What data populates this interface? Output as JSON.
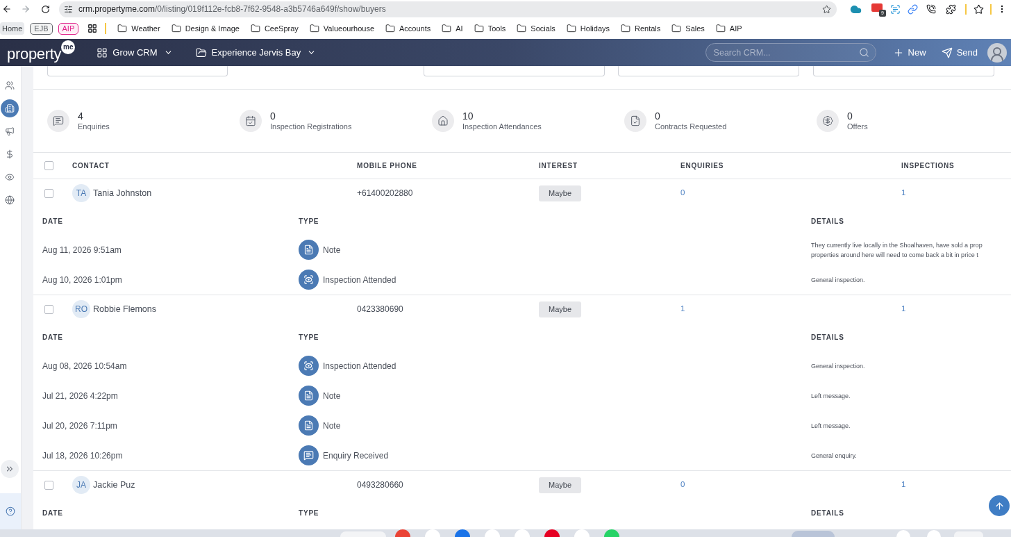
{
  "browser": {
    "url_host": "crm.propertyme.com",
    "url_path": "/0/listing/019f112e-fcb8-7f62-9548-a3b5746a649f/show/buyers",
    "extension_badge": "9",
    "bookmarks": [
      {
        "kind": "plain",
        "label": "Home"
      },
      {
        "kind": "tag",
        "label": "EJB",
        "color": "#5f6368"
      },
      {
        "kind": "tag",
        "label": "AIP",
        "color": "#e0218a"
      },
      {
        "kind": "apps"
      },
      {
        "kind": "separator"
      },
      {
        "kind": "folder",
        "label": "Weather"
      },
      {
        "kind": "folder",
        "label": "Design & Image"
      },
      {
        "kind": "folder",
        "label": "CeeSpray"
      },
      {
        "kind": "folder",
        "label": "Valueourhouse"
      },
      {
        "kind": "folder",
        "label": "Accounts"
      },
      {
        "kind": "folder",
        "label": "AI"
      },
      {
        "kind": "folder",
        "label": "Tools"
      },
      {
        "kind": "folder",
        "label": "Socials"
      },
      {
        "kind": "folder",
        "label": "Holidays"
      },
      {
        "kind": "folder",
        "label": "Rentals"
      },
      {
        "kind": "folder",
        "label": "Sales"
      },
      {
        "kind": "folder",
        "label": "AIP"
      }
    ]
  },
  "app_header": {
    "logo": {
      "text": "property",
      "badge": "me"
    },
    "nav": [
      {
        "kind": "module",
        "label": "Grow CRM"
      },
      {
        "kind": "folder",
        "label": "Experience Jervis Bay"
      }
    ],
    "search": {
      "placeholder": "Search CRM..."
    },
    "actions": [
      {
        "kind": "new",
        "label": "New"
      },
      {
        "kind": "send",
        "label": "Send"
      }
    ]
  },
  "sidebar": {
    "items": [
      {
        "kind": "contacts",
        "selected": false
      },
      {
        "kind": "listings",
        "selected": true
      },
      {
        "kind": "marketing",
        "selected": false
      },
      {
        "kind": "finance",
        "selected": false
      },
      {
        "kind": "inspections",
        "selected": false
      },
      {
        "kind": "website",
        "selected": false
      }
    ]
  },
  "stats": [
    {
      "kind": "enquiry",
      "value": "4",
      "label": "Enquiries"
    },
    {
      "kind": "registration",
      "value": "0",
      "label": "Inspection Registrations"
    },
    {
      "kind": "attendance",
      "value": "10",
      "label": "Inspection Attendances"
    },
    {
      "kind": "contract",
      "value": "0",
      "label": "Contracts Requested"
    },
    {
      "kind": "offer",
      "value": "0",
      "label": "Offers"
    }
  ],
  "table": {
    "all_checked": false,
    "columns": [
      "CONTACT",
      "MOBILE PHONE",
      "INTEREST",
      "ENQUIRIES",
      "INSPECTIONS"
    ],
    "rows": [
      {
        "checked": false,
        "initials": "TA",
        "name": "Tania Johnston",
        "phone": "+61400202880",
        "interest": "Maybe",
        "enquiries": "0",
        "inspections": "1",
        "activity_columns": [
          "DATE",
          "TYPE",
          "DETAILS"
        ],
        "activities": [
          {
            "kind": "note",
            "date": "Aug 11, 2026 9:51am",
            "type": "Note",
            "details": [
              "They currently live locally in the Shoalhaven, have sold a prop",
              "properties around here will need to come back a bit in price t"
            ]
          },
          {
            "kind": "inspection",
            "date": "Aug 10, 2026 1:01pm",
            "type": "Inspection Attended",
            "details": [
              "General inspection."
            ]
          }
        ]
      },
      {
        "checked": false,
        "initials": "RO",
        "name": "Robbie Flemons",
        "phone": "0423380690",
        "interest": "Maybe",
        "enquiries": "1",
        "inspections": "1",
        "activity_columns": [
          "DATE",
          "TYPE",
          "DETAILS"
        ],
        "activities": [
          {
            "kind": "inspection",
            "date": "Aug 08, 2026 10:54am",
            "type": "Inspection Attended",
            "details": [
              "General inspection."
            ]
          },
          {
            "kind": "note",
            "date": "Jul 21, 2026 4:22pm",
            "type": "Note",
            "details": [
              "Left message."
            ]
          },
          {
            "kind": "note",
            "date": "Jul 20, 2026 7:11pm",
            "type": "Note",
            "details": [
              "Left message."
            ]
          },
          {
            "kind": "enquiry",
            "date": "Jul 18, 2026 10:26pm",
            "type": "Enquiry Received",
            "details": [
              "General enquiry."
            ]
          }
        ]
      },
      {
        "checked": false,
        "initials": "JA",
        "name": "Jackie Puz",
        "phone": "0493280660",
        "interest": "Maybe",
        "enquiries": "0",
        "inspections": "1",
        "activity_columns": [
          "DATE",
          "TYPE",
          "DETAILS"
        ]
      }
    ]
  }
}
